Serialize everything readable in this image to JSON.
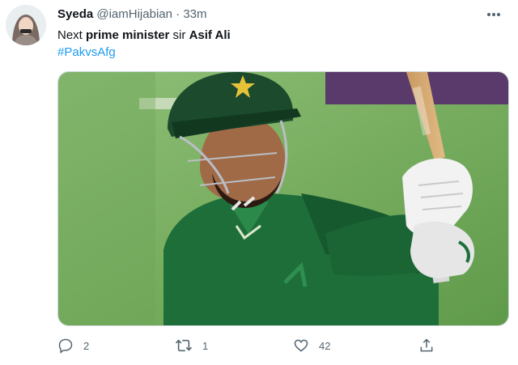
{
  "tweet": {
    "author_name": "Syeda",
    "handle": "@iamHijabian",
    "separator": "·",
    "time": "33m",
    "text_part1": "Next ",
    "text_bold1": "prime minister",
    "text_part2": " sir ",
    "text_bold2": "Asif Ali",
    "hashtag": "#PakvsAfg"
  },
  "actions": {
    "reply_count": "2",
    "retweet_count": "1",
    "like_count": "42"
  },
  "icons": {
    "more": "more-horizontal-icon",
    "reply": "reply-icon",
    "retweet": "retweet-icon",
    "like": "heart-icon",
    "share": "share-icon"
  },
  "colors": {
    "text": "#0f1419",
    "muted": "#536471",
    "link": "#1d9bf0",
    "jersey_green": "#1e6e3a"
  }
}
